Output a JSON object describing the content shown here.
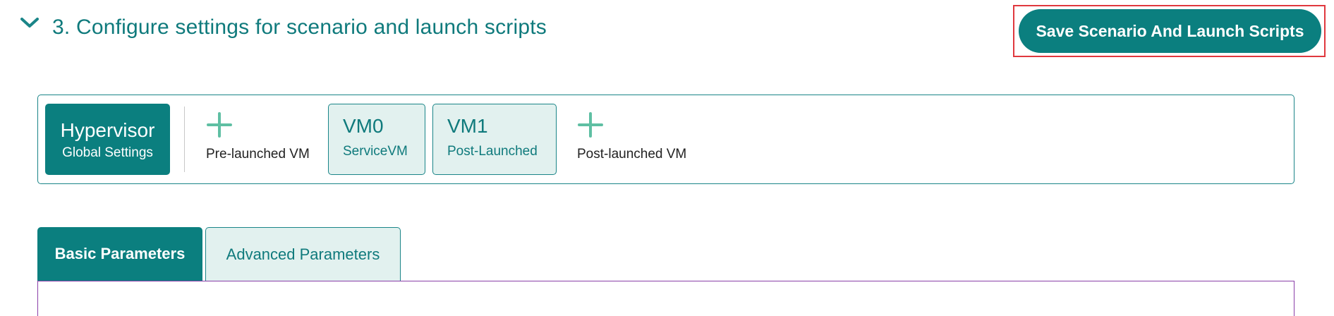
{
  "section": {
    "title": "3. Configure settings for scenario and launch scripts",
    "save_button_label": "Save Scenario And Launch Scripts"
  },
  "vm_bar": {
    "hypervisor": {
      "title": "Hypervisor",
      "subtitle": "Global Settings"
    },
    "add_pre_launched_label": "Pre-launched VM",
    "vms": [
      {
        "name": "VM0",
        "type": "ServiceVM"
      },
      {
        "name": "VM1",
        "type": "Post-Launched"
      }
    ],
    "add_post_launched_label": "Post-launched VM"
  },
  "tabs": [
    {
      "label": "Basic Parameters",
      "active": true
    },
    {
      "label": "Advanced Parameters",
      "active": false
    }
  ],
  "icons": {
    "collapse": "chevron-down-icon",
    "add": "plus-icon"
  },
  "colors": {
    "primary": "#0b7f7f",
    "primary_text": "#0f7a7c",
    "light_fill": "#e2f1ef",
    "plus": "#5fbfa3",
    "highlight": "#e0383e",
    "panel_border": "#8a3ea8"
  }
}
